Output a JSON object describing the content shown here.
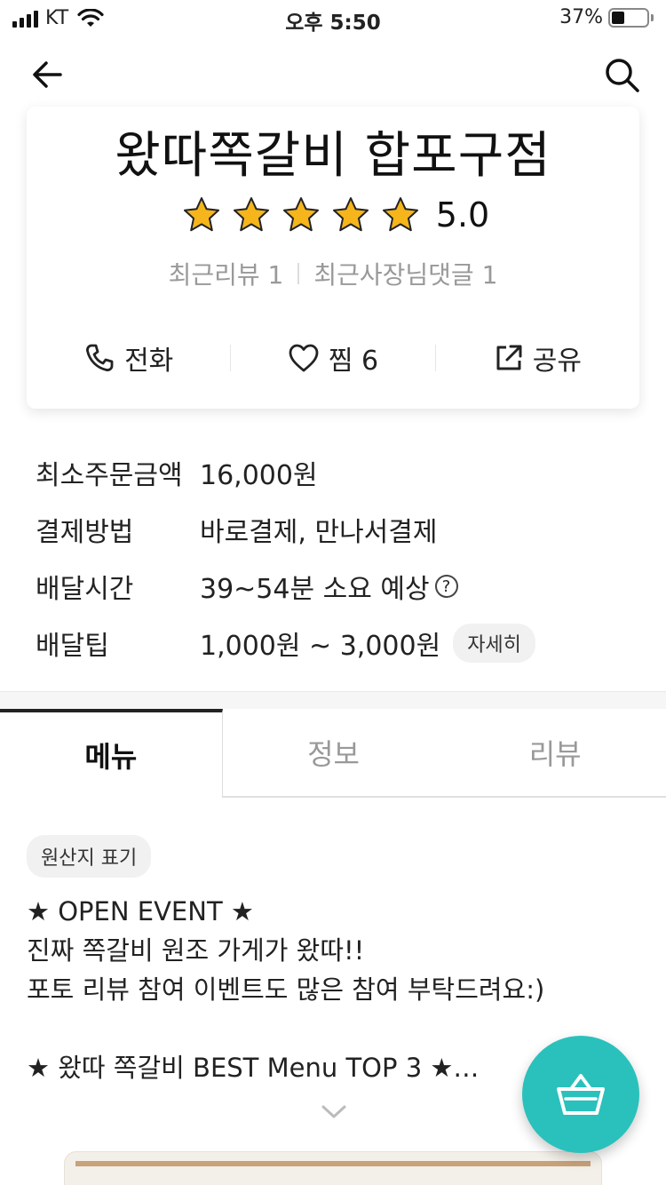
{
  "status_bar": {
    "carrier": "KT",
    "time": "오후 5:50",
    "battery_percent": "37%",
    "battery_level": 0.37
  },
  "nav": {
    "back_icon": "arrow-left-icon",
    "search_icon": "search-icon"
  },
  "store": {
    "name": "왔따쪽갈비 합포구점",
    "rating": "5.0",
    "stars": 5,
    "recent_reviews": "최근리뷰 1",
    "recent_owner_replies": "최근사장님댓글 1",
    "actions": {
      "call": "전화",
      "favorite": "찜 6",
      "share": "공유"
    }
  },
  "info": {
    "min_order_label": "최소주문금액",
    "min_order_value": "16,000원",
    "payment_label": "결제방법",
    "payment_value": "바로결제, 만나서결제",
    "delivery_time_label": "배달시간",
    "delivery_time_value": "39~54분 소요 예상",
    "help_icon": "?",
    "tip_label": "배달팁",
    "tip_value": "1,000원 ~ 3,000원",
    "tip_detail": "자세히"
  },
  "tabs": [
    {
      "label": "메뉴",
      "active": true
    },
    {
      "label": "정보",
      "active": false
    },
    {
      "label": "리뷰",
      "active": false
    }
  ],
  "menu": {
    "origin_label": "원산지 표기",
    "notice_lines": [
      "★ OPEN EVENT ★",
      "진짜 쪽갈비 원조 가게가 왔따!!",
      "포토 리뷰 참여 이벤트도 많은 참여 부탁드려요:)",
      "",
      "★ 왔따 쪽갈비 BEST Menu TOP 3 ★…"
    ]
  },
  "colors": {
    "accent": "#2ac1bc",
    "star": "#f5b51b"
  }
}
